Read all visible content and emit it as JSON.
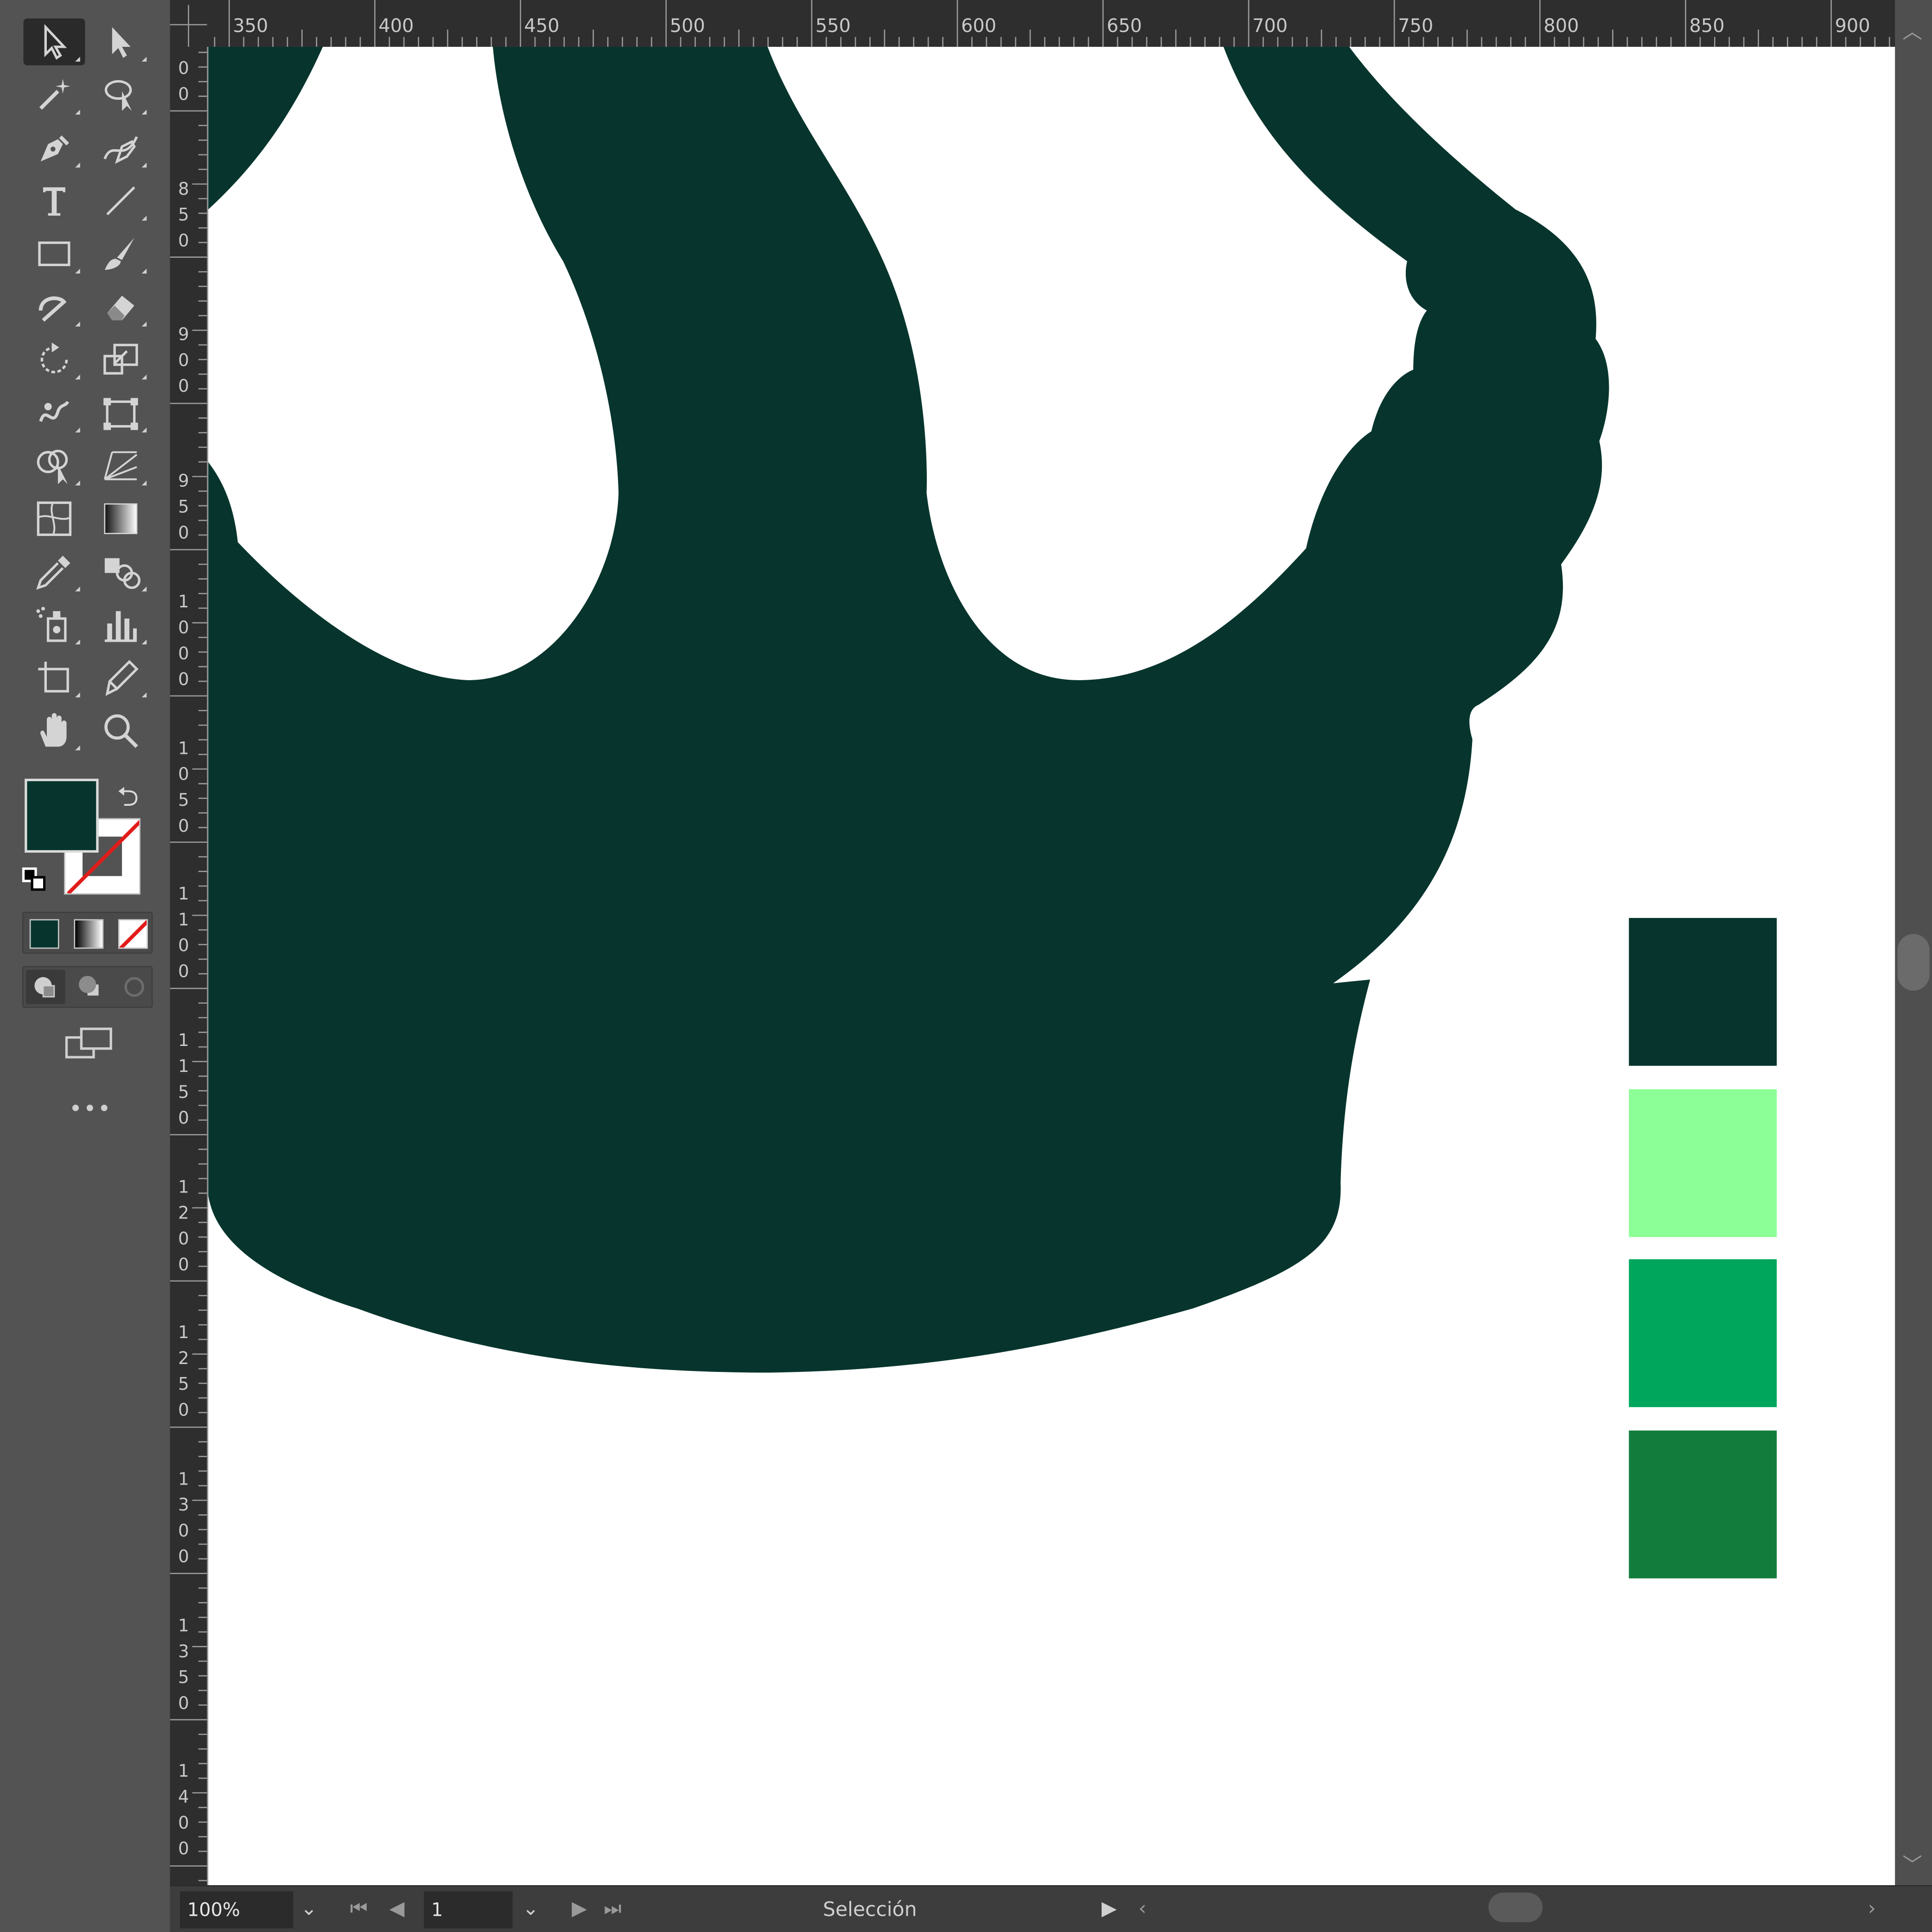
{
  "statusbar": {
    "zoom_value": "100%",
    "artboard_value": "1",
    "current_tool": "Selección"
  },
  "hruler_labels": [
    "350",
    "400",
    "450",
    "500",
    "550",
    "600",
    "650",
    "700",
    "750",
    "800",
    "850",
    "900"
  ],
  "vruler_labels": [
    [
      "0",
      "0"
    ],
    [
      "8",
      "5",
      "0"
    ],
    [
      "9",
      "0",
      "0"
    ],
    [
      "9",
      "5",
      "0"
    ],
    [
      "1",
      "0",
      "0",
      "0"
    ],
    [
      "1",
      "0",
      "5",
      "0"
    ],
    [
      "1",
      "1",
      "0",
      "0"
    ],
    [
      "1",
      "1",
      "5",
      "0"
    ],
    [
      "1",
      "2",
      "0",
      "0"
    ],
    [
      "1",
      "2",
      "5",
      "0"
    ],
    [
      "1",
      "3",
      "0",
      "0"
    ],
    [
      "1",
      "3",
      "5",
      "0"
    ],
    [
      "1",
      "4",
      "0",
      "0"
    ]
  ],
  "colors": {
    "fill": "#07352d",
    "artwork": "#07352d",
    "swatches": [
      "#07352d",
      "#8dff97",
      "#00a65c",
      "#127c3c"
    ]
  },
  "tools": [
    {
      "name": "selection-tool-icon",
      "active": true
    },
    {
      "name": "direct-selection-tool-icon"
    },
    {
      "name": "magic-wand-tool-icon"
    },
    {
      "name": "lasso-tool-icon"
    },
    {
      "name": "pen-tool-icon"
    },
    {
      "name": "curvature-tool-icon"
    },
    {
      "name": "type-tool-icon"
    },
    {
      "name": "line-segment-tool-icon"
    },
    {
      "name": "rectangle-tool-icon"
    },
    {
      "name": "paintbrush-tool-icon"
    },
    {
      "name": "shaper-tool-icon"
    },
    {
      "name": "eraser-tool-icon"
    },
    {
      "name": "rotate-tool-icon"
    },
    {
      "name": "scale-tool-icon"
    },
    {
      "name": "warp-tool-icon"
    },
    {
      "name": "free-transform-tool-icon"
    },
    {
      "name": "shape-builder-tool-icon"
    },
    {
      "name": "perspective-grid-tool-icon"
    },
    {
      "name": "mesh-tool-icon"
    },
    {
      "name": "gradient-tool-icon"
    },
    {
      "name": "eyedropper-tool-icon"
    },
    {
      "name": "blend-tool-icon"
    },
    {
      "name": "symbol-sprayer-tool-icon"
    },
    {
      "name": "column-graph-tool-icon"
    },
    {
      "name": "artboard-tool-icon"
    },
    {
      "name": "slice-tool-icon"
    },
    {
      "name": "hand-tool-icon"
    },
    {
      "name": "zoom-tool-icon"
    }
  ],
  "toolbar_more": "•••"
}
